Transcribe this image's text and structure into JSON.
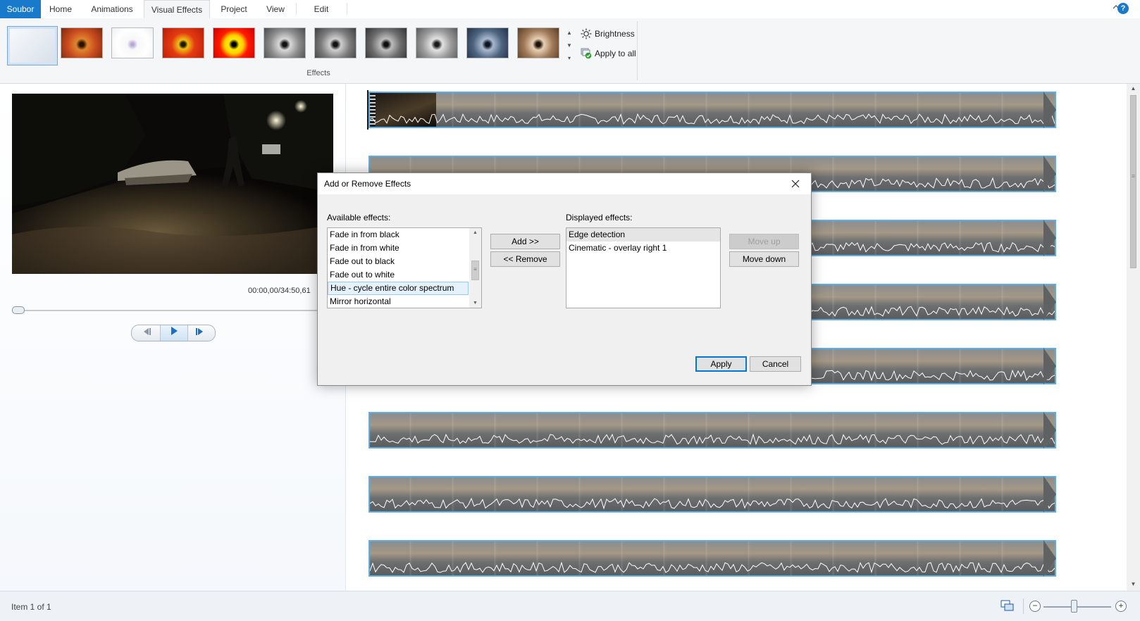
{
  "tabs": [
    {
      "label": "Soubor"
    },
    {
      "label": "Home"
    },
    {
      "label": "Animations"
    },
    {
      "label": "Visual Effects"
    },
    {
      "label": "Project"
    },
    {
      "label": "View"
    },
    {
      "label": "Edit"
    }
  ],
  "window_controls": {
    "minimize_ribbon_icon": "chevron-up-icon",
    "help_label": "?"
  },
  "ribbon": {
    "effect_thumbnails": [
      {
        "name": "no-effect",
        "selected": true,
        "color": "#e9eef6"
      },
      {
        "name": "warm",
        "selected": false,
        "color": "#d0582a"
      },
      {
        "name": "edge-detection",
        "selected": false,
        "color": "#f4f4f4"
      },
      {
        "name": "threshold",
        "selected": false,
        "color": "#e63a14"
      },
      {
        "name": "posterize",
        "selected": false,
        "color": "#f0d010"
      },
      {
        "name": "grayscale-1",
        "selected": false,
        "color": "#8a8a8a"
      },
      {
        "name": "grayscale-2",
        "selected": false,
        "color": "#7a7a7a"
      },
      {
        "name": "grayscale-3",
        "selected": false,
        "color": "#6a6a6a"
      },
      {
        "name": "grayscale-4",
        "selected": false,
        "color": "#9a9a9a"
      },
      {
        "name": "cyanotype",
        "selected": false,
        "color": "#4d6480"
      },
      {
        "name": "sepia",
        "selected": false,
        "color": "#a07a58"
      }
    ],
    "brightness_label": "Brightness",
    "apply_to_all_label": "Apply to all",
    "group_label": "Effects"
  },
  "preview": {
    "timecode": "00:00,00/34:50,61",
    "seek_position": 0
  },
  "storyboard": {
    "clip_count_visible": 8,
    "accent_color": "#5faee0"
  },
  "status": {
    "item_text": "Item 1 of 1"
  },
  "dialog": {
    "title": "Add or Remove Effects",
    "available_label": "Available effects:",
    "available_items": [
      "Fade in from black",
      "Fade in from white",
      "Fade out to black",
      "Fade out to white",
      "Hue - cycle entire color spectrum",
      "Mirror horizontal"
    ],
    "available_highlighted_index": 4,
    "add_label": "Add >>",
    "remove_label": "<< Remove",
    "displayed_label": "Displayed effects:",
    "displayed_items": [
      "Edge detection",
      "Cinematic - overlay right 1"
    ],
    "displayed_selected_index": 0,
    "move_up_label": "Move up",
    "move_down_label": "Move down",
    "apply_label": "Apply",
    "cancel_label": "Cancel"
  }
}
